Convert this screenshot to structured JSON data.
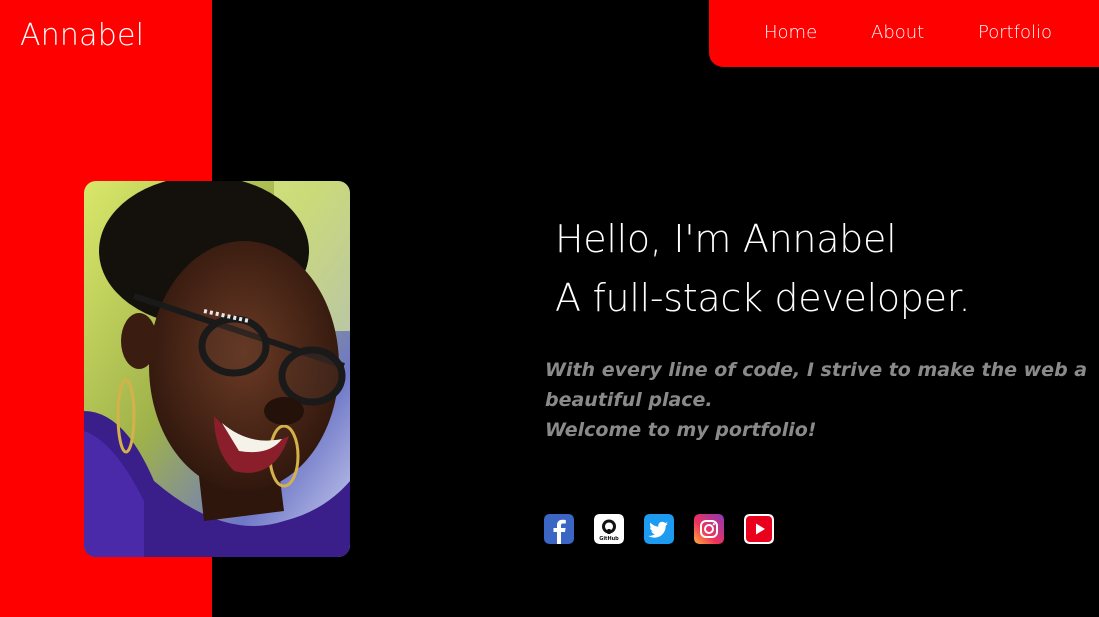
{
  "brand": {
    "name": "Annabel"
  },
  "nav": {
    "items": [
      {
        "label": "Home"
      },
      {
        "label": "About"
      },
      {
        "label": "Portfolio"
      }
    ]
  },
  "hero": {
    "greeting": "Hello, I'm Annabel",
    "role": "A full-stack developer.",
    "tagline_line1": "With every line of code, I strive to make the web a",
    "tagline_line2": "beautiful place.",
    "tagline_line3": "Welcome to my portfolio!"
  },
  "socials": [
    {
      "icon": "facebook-icon"
    },
    {
      "icon": "github-icon",
      "text": "GitHub"
    },
    {
      "icon": "twitter-icon"
    },
    {
      "icon": "instagram-icon"
    },
    {
      "icon": "youtube-icon"
    }
  ],
  "colors": {
    "accent": "#ff0000",
    "background": "#000000",
    "text": "#ffffff",
    "muted": "#8a8a8a"
  }
}
